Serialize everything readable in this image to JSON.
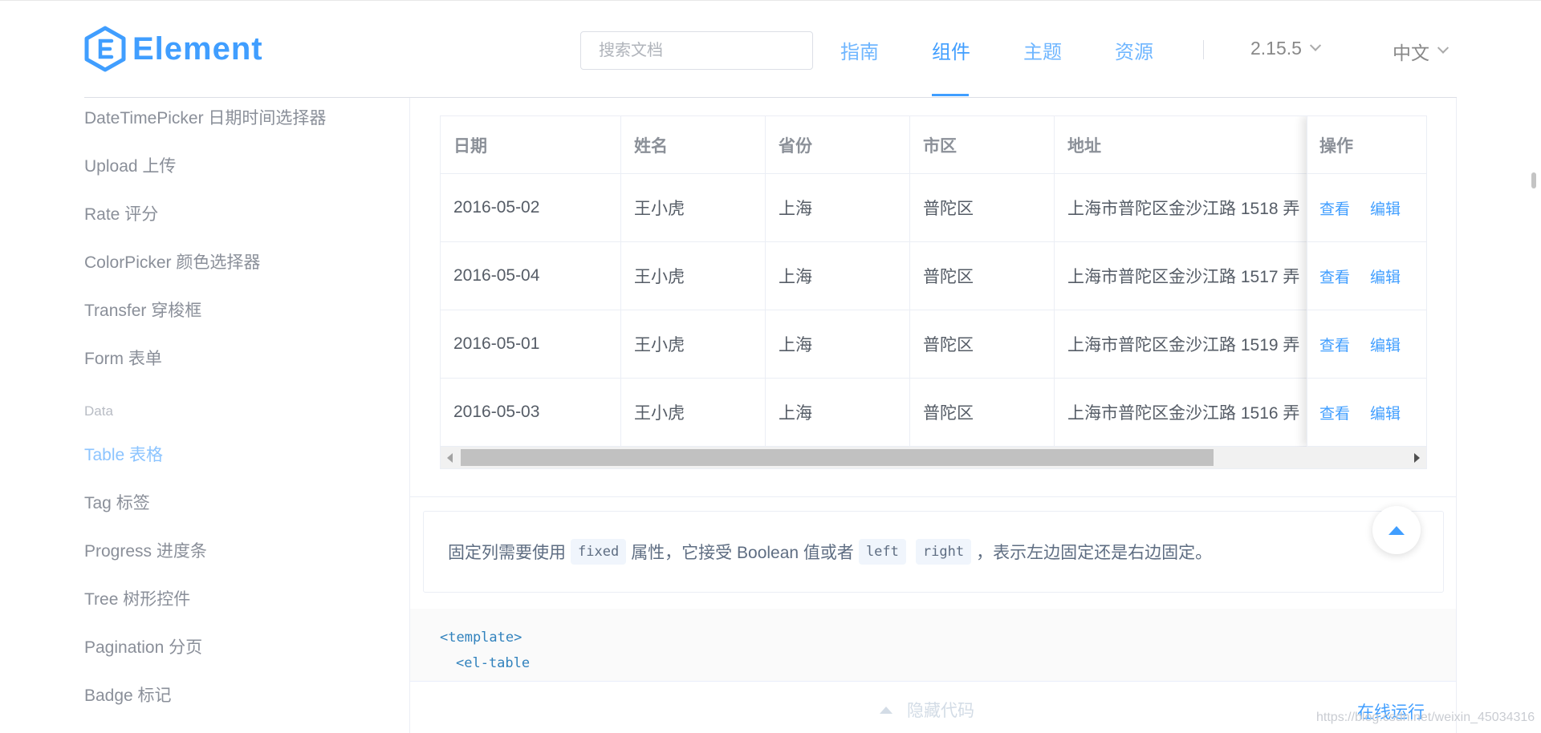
{
  "header": {
    "brand": "Element",
    "search_placeholder": "搜索文档",
    "nav": [
      "指南",
      "组件",
      "主题",
      "资源"
    ],
    "nav_active": "组件",
    "version": "2.15.5",
    "language": "中文"
  },
  "sidebar": {
    "items_top": [
      "DateTimePicker 日期时间选择器",
      "Upload 上传",
      "Rate 评分",
      "ColorPicker 颜色选择器",
      "Transfer 穿梭框",
      "Form 表单"
    ],
    "group_label": "Data",
    "items_bottom": [
      "Table 表格",
      "Tag 标签",
      "Progress 进度条",
      "Tree 树形控件",
      "Pagination 分页",
      "Badge 标记"
    ],
    "active_item": "Table 表格"
  },
  "table": {
    "columns": [
      "日期",
      "姓名",
      "省份",
      "市区",
      "地址"
    ],
    "action_header": "操作",
    "rows": [
      [
        "2016-05-02",
        "王小虎",
        "上海",
        "普陀区",
        "上海市普陀区金沙江路 1518 弄"
      ],
      [
        "2016-05-04",
        "王小虎",
        "上海",
        "普陀区",
        "上海市普陀区金沙江路 1517 弄"
      ],
      [
        "2016-05-01",
        "王小虎",
        "上海",
        "普陀区",
        "上海市普陀区金沙江路 1519 弄"
      ],
      [
        "2016-05-03",
        "王小虎",
        "上海",
        "普陀区",
        "上海市普陀区金沙江路 1516 弄"
      ]
    ],
    "actions": [
      "查看",
      "编辑"
    ]
  },
  "description": {
    "text_1": "固定列需要使用",
    "chip_1": "fixed",
    "text_2": "属性，它接受 Boolean 值或者",
    "chip_2": "left",
    "chip_3": "right",
    "text_3": "，表示左边固定还是右边固定。"
  },
  "code": {
    "line_1": "<template>",
    "line_2": "<el-table"
  },
  "controls": {
    "hide_code": "隐藏代码",
    "run_online": "在线运行"
  },
  "watermark": "https://blog.csdn.net/weixin_45034316",
  "colors": {
    "primary": "#409eff",
    "text": "#5e6d82",
    "border": "#ebeef5"
  }
}
